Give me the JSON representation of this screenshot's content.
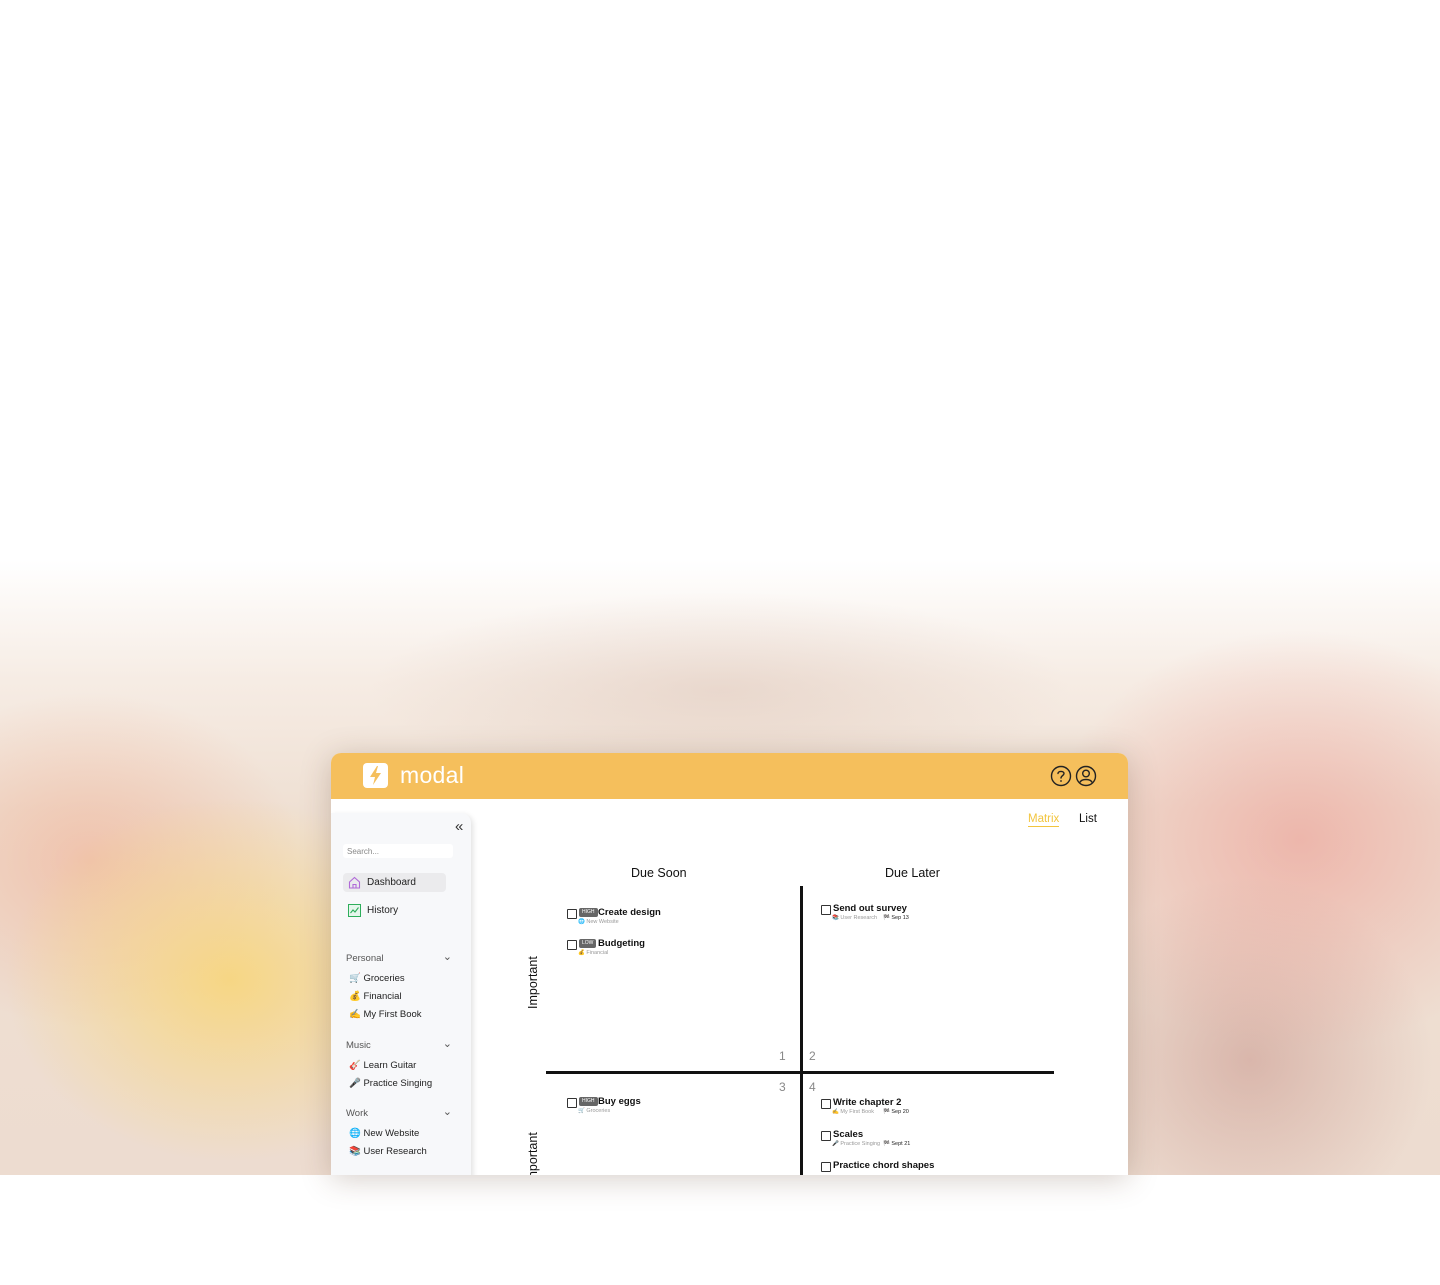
{
  "colors": {
    "topbar": "#f5bf5c",
    "accent_tab": "#f2c53f",
    "sidebar_bg": "#f7f8fa",
    "badge_bg": "#666666"
  },
  "app": {
    "title": "modal",
    "logo_icon": "lightning-bolt-icon",
    "help_icon": "question-circle-icon",
    "profile_icon": "user-circle-icon"
  },
  "sidebar": {
    "collapse_icon": "«",
    "search_placeholder": "Search...",
    "nav": [
      {
        "label": "Dashboard",
        "icon": "home-icon",
        "active": true
      },
      {
        "label": "History",
        "icon": "chart-icon",
        "active": false
      }
    ],
    "groups": [
      {
        "label": "Personal",
        "chevron": "⌄",
        "items": [
          "🛒 Groceries",
          "💰 Financial",
          "✍️ My First Book"
        ]
      },
      {
        "label": "Music",
        "chevron": "⌄",
        "items": [
          "🎸 Learn Guitar",
          "🎤 Practice Singing"
        ]
      },
      {
        "label": "Work",
        "chevron": "⌄",
        "items": [
          "🌐 New Website",
          "📚 User Research"
        ]
      }
    ]
  },
  "view_tabs": {
    "matrix": "Matrix",
    "list": "List",
    "active": "matrix"
  },
  "matrix": {
    "col_headings": [
      "Due Soon",
      "Due Later"
    ],
    "row_headings": [
      "Important",
      "Important"
    ],
    "quadrant_numbers": [
      "1",
      "2",
      "3",
      "4"
    ],
    "tasks": {
      "q1": [
        {
          "badge": "HIGH",
          "name": "Create design",
          "project": "🌐 New Website"
        },
        {
          "badge": "LOW",
          "name": "Budgeting",
          "project": "💰 Financial"
        }
      ],
      "q2": [
        {
          "name": "Send out survey",
          "project": "📚 User Research",
          "due": "🏁 Sep 13"
        }
      ],
      "q3": [
        {
          "badge": "HIGH",
          "name": "Buy eggs",
          "project": "🛒 Groceries"
        }
      ],
      "q4": [
        {
          "name": "Write chapter 2",
          "project": "✍️ My First Book",
          "due": "🏁 Sep 20"
        },
        {
          "name": "Scales",
          "project": "🎤 Practice Singing",
          "due": "🏁 Sept 21"
        },
        {
          "name": "Practice chord shapes",
          "project": "",
          "due": ""
        }
      ]
    }
  }
}
